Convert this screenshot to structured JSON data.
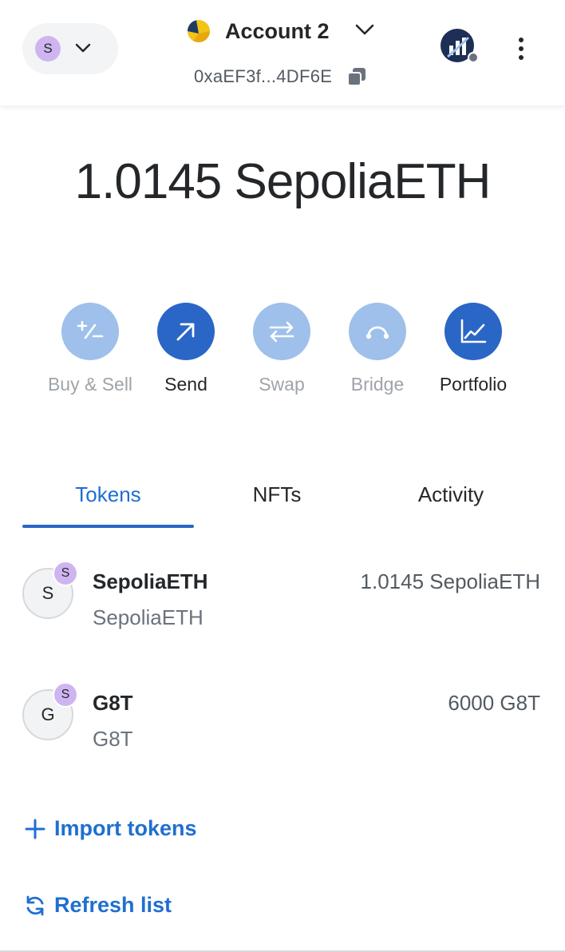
{
  "header": {
    "network_initial": "S",
    "account_name": "Account 2",
    "address": "0xaEF3f...4DF6E"
  },
  "balance": "1.0145 SepoliaETH",
  "actions": [
    {
      "label": "Buy & Sell",
      "icon": "plus-minus-icon",
      "state": "disabled"
    },
    {
      "label": "Send",
      "icon": "arrow-up-right-icon",
      "state": "active"
    },
    {
      "label": "Swap",
      "icon": "swap-arrows-icon",
      "state": "disabled"
    },
    {
      "label": "Bridge",
      "icon": "bridge-icon",
      "state": "disabled"
    },
    {
      "label": "Portfolio",
      "icon": "chart-icon",
      "state": "active"
    }
  ],
  "tabs": [
    {
      "label": "Tokens",
      "selected": true
    },
    {
      "label": "NFTs",
      "selected": false
    },
    {
      "label": "Activity",
      "selected": false
    }
  ],
  "tokens": [
    {
      "initial": "S",
      "badge": "S",
      "name": "SepoliaETH",
      "subtitle": "SepoliaETH",
      "amount": "1.0145 SepoliaETH"
    },
    {
      "initial": "G",
      "badge": "S",
      "name": "G8T",
      "subtitle": "G8T",
      "amount": "6000 G8T"
    }
  ],
  "links": {
    "import_tokens": "Import tokens",
    "refresh_list": "Refresh list"
  },
  "colors": {
    "accent": "#2a66c6",
    "accent_disabled": "#9ec0ea",
    "link": "#1f6fd0",
    "network_avatar": "#cfb5f0"
  }
}
